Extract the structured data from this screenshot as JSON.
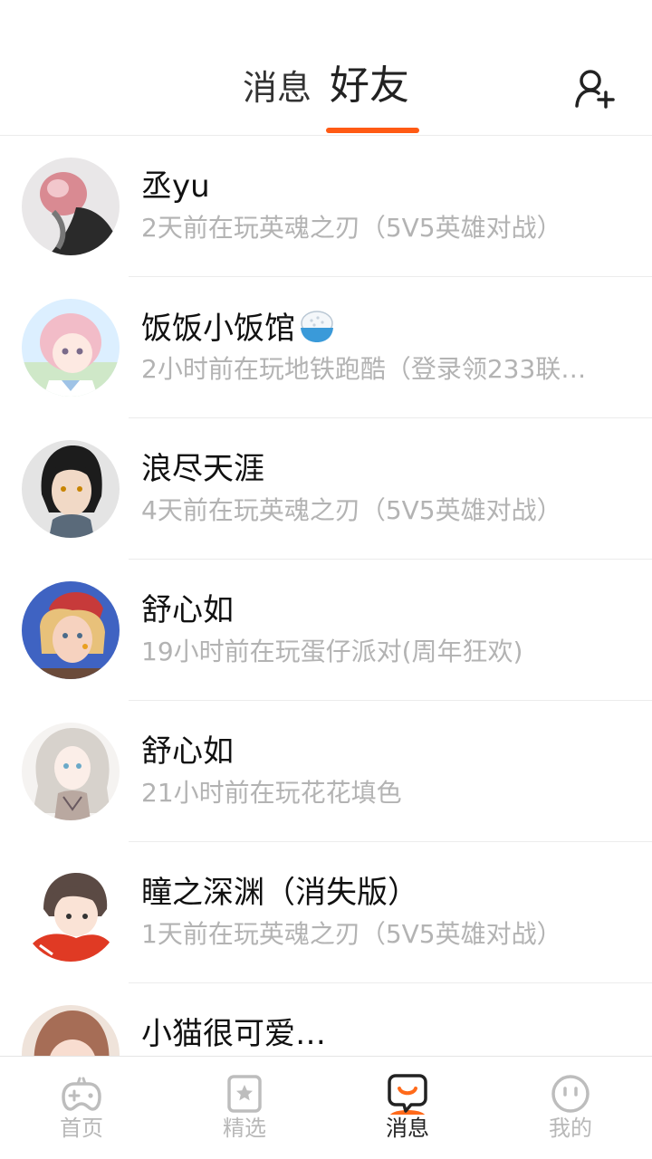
{
  "header": {
    "tabs": [
      {
        "label": "消息",
        "active": false
      },
      {
        "label": "好友",
        "active": true
      }
    ],
    "add_friend_icon": "add-user-icon",
    "accent": "#ff5a14"
  },
  "friends": [
    {
      "name": "丞yu",
      "status": "2天前在玩英魂之刃（5V5英雄对战）"
    },
    {
      "name": "饭饭小饭馆",
      "status": "2小时前在玩地铁跑酷（登录领233联…",
      "emoji": "rice-bowl-icon"
    },
    {
      "name": "浪尽天涯",
      "status": "4天前在玩英魂之刃（5V5英雄对战）"
    },
    {
      "name": "舒心如",
      "status": "19小时前在玩蛋仔派对(周年狂欢)"
    },
    {
      "name": "舒心如",
      "status": "21小时前在玩花花填色"
    },
    {
      "name": "瞳之深渊（消失版）",
      "status": "1天前在玩英魂之刃（5V5英雄对战）"
    },
    {
      "name": "小猫很可爱…",
      "status": ""
    }
  ],
  "bottom_nav": [
    {
      "label": "首页",
      "icon": "gamepad-icon",
      "active": false
    },
    {
      "label": "精选",
      "icon": "star-card-icon",
      "active": false
    },
    {
      "label": "消息",
      "icon": "chat-bubble-icon",
      "active": true
    },
    {
      "label": "我的",
      "icon": "face-icon",
      "active": false
    }
  ]
}
